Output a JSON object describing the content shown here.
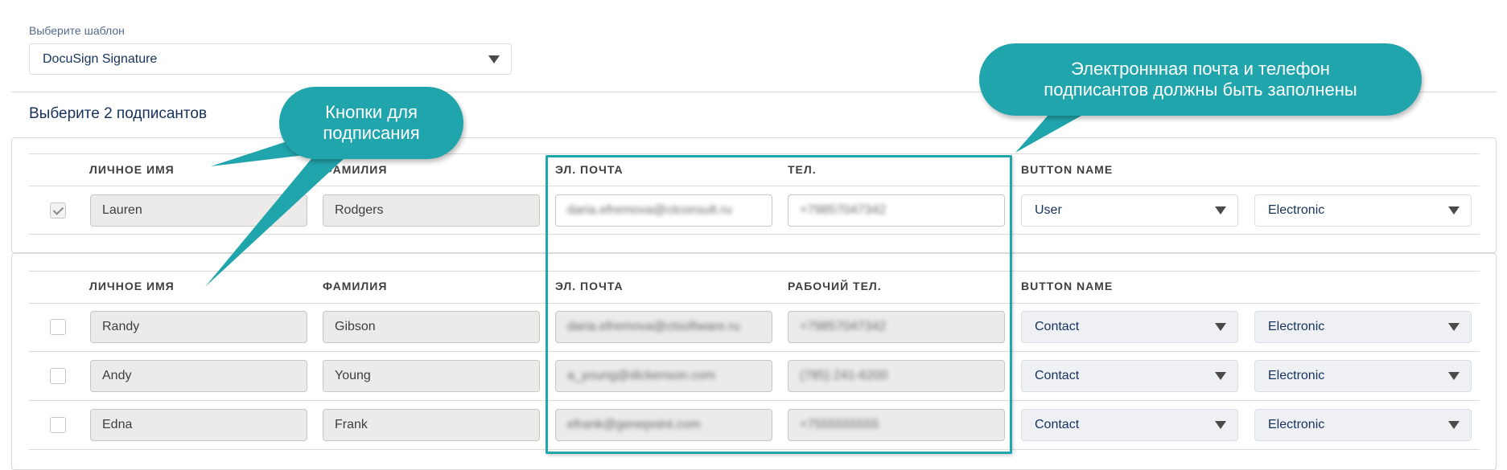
{
  "template": {
    "label": "Выберите шаблон",
    "value": "DocuSign Signature"
  },
  "signers_title": "Выберите 2 подписантов",
  "section1": {
    "headers": {
      "first": "ЛИЧНОЕ ИМЯ",
      "last": "ФАМИЛИЯ",
      "email": "ЭЛ. ПОЧТА",
      "phone": "ТЕЛ.",
      "button": "BUTTON NAME"
    },
    "rows": [
      {
        "checked": true,
        "first": "Lauren",
        "last": "Rodgers",
        "email": "daria.efremova@ctconsult.ru",
        "phone": "+79857047342",
        "role": "User",
        "type": "Electronic"
      }
    ]
  },
  "section2": {
    "headers": {
      "first": "ЛИЧНОЕ ИМЯ",
      "last": "ФАМИЛИЯ",
      "email": "ЭЛ. ПОЧТА",
      "phone": "РАБОЧИЙ ТЕЛ.",
      "button": "BUTTON NAME"
    },
    "rows": [
      {
        "checked": false,
        "first": "Randy",
        "last": "Gibson",
        "email": "daria.efremova@ctsoftware.ru",
        "phone": "+79857047342",
        "role": "Contact",
        "type": "Electronic"
      },
      {
        "checked": false,
        "first": "Andy",
        "last": "Young",
        "email": "a_young@dickenson.com",
        "phone": "(785) 241-6200",
        "role": "Contact",
        "type": "Electronic"
      },
      {
        "checked": false,
        "first": "Edna",
        "last": "Frank",
        "email": "efrank@genepoint.com",
        "phone": "+7555555555",
        "role": "Contact",
        "type": "Electronic"
      }
    ]
  },
  "callouts": {
    "buttons": "Кнопки для подписания",
    "contacts": "Электроннная почта и телефон подписантов должны быть заполнены"
  },
  "colors": {
    "accent": "#21a5ad",
    "text": "#16325c",
    "border": "#dddbda"
  }
}
